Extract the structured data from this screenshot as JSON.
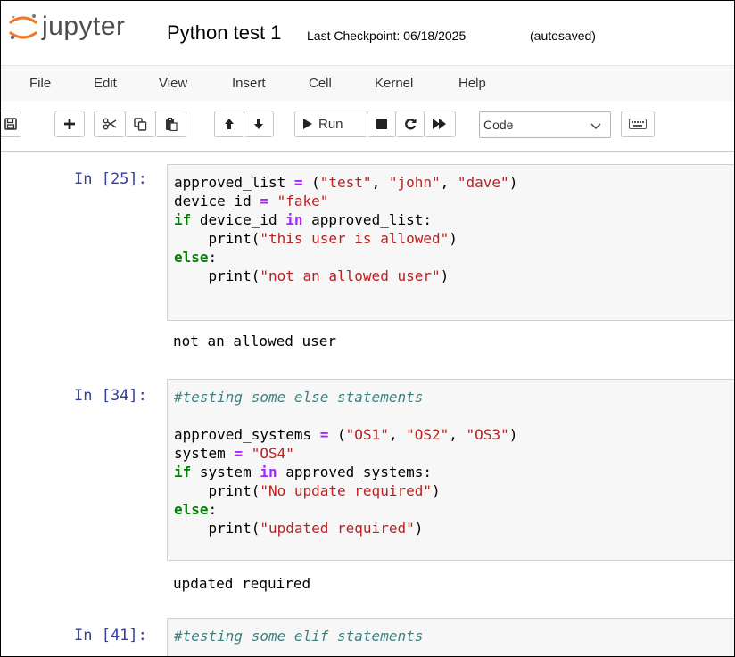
{
  "header": {
    "logo_text": "jupyter",
    "notebook_title": "Python test 1",
    "checkpoint": "Last Checkpoint: 06/18/2025",
    "autosave_status": "(autosaved)",
    "logo_color": "#f37726"
  },
  "menu": {
    "file": "File",
    "edit": "Edit",
    "view": "View",
    "insert": "Insert",
    "cell": "Cell",
    "kernel": "Kernel",
    "help": "Help"
  },
  "toolbar": {
    "run_label": "Run",
    "cell_type": "Code",
    "icons": [
      "save-icon",
      "plus-icon",
      "scissors-icon",
      "copy-icon",
      "paste-icon",
      "arrow-up-icon",
      "arrow-down-icon",
      "play-icon",
      "stop-icon",
      "restart-icon",
      "fast-forward-icon",
      "keyboard-icon"
    ]
  },
  "cells": [
    {
      "prompt": "In [25]:",
      "code_lines": [
        [
          [
            "n",
            "approved_list "
          ],
          [
            "op",
            "="
          ],
          [
            "n",
            " ("
          ],
          [
            "str",
            "\"test\""
          ],
          [
            "n",
            ", "
          ],
          [
            "str",
            "\"john\""
          ],
          [
            "n",
            ", "
          ],
          [
            "str",
            "\"dave\""
          ],
          [
            "n",
            ")"
          ]
        ],
        [
          [
            "n",
            "device_id "
          ],
          [
            "op",
            "="
          ],
          [
            "n",
            " "
          ],
          [
            "str",
            "\"fake\""
          ]
        ],
        [
          [
            "kw",
            "if"
          ],
          [
            "n",
            " device_id "
          ],
          [
            "op",
            "in"
          ],
          [
            "n",
            " approved_list:"
          ]
        ],
        [
          [
            "n",
            "    print("
          ],
          [
            "str",
            "\"this user is allowed\""
          ],
          [
            "n",
            ")"
          ]
        ],
        [
          [
            "kw",
            "else"
          ],
          [
            "n",
            ":"
          ]
        ],
        [
          [
            "n",
            "    print("
          ],
          [
            "str",
            "\"not an allowed user\""
          ],
          [
            "n",
            ")"
          ]
        ]
      ],
      "output": "not an allowed user"
    },
    {
      "prompt": "In [34]:",
      "code_lines": [
        [
          [
            "cm",
            "#testing some else statements"
          ]
        ],
        [
          [
            "n",
            ""
          ]
        ],
        [
          [
            "n",
            "approved_systems "
          ],
          [
            "op",
            "="
          ],
          [
            "n",
            " ("
          ],
          [
            "str",
            "\"OS1\""
          ],
          [
            "n",
            ", "
          ],
          [
            "str",
            "\"OS2\""
          ],
          [
            "n",
            ", "
          ],
          [
            "str",
            "\"OS3\""
          ],
          [
            "n",
            ")"
          ]
        ],
        [
          [
            "n",
            "system "
          ],
          [
            "op",
            "="
          ],
          [
            "n",
            " "
          ],
          [
            "str",
            "\"OS4\""
          ]
        ],
        [
          [
            "kw",
            "if"
          ],
          [
            "n",
            " system "
          ],
          [
            "op",
            "in"
          ],
          [
            "n",
            " approved_systems:"
          ]
        ],
        [
          [
            "n",
            "    print("
          ],
          [
            "str",
            "\"No update required\""
          ],
          [
            "n",
            ")"
          ]
        ],
        [
          [
            "kw",
            "else"
          ],
          [
            "n",
            ":"
          ]
        ],
        [
          [
            "n",
            "    print("
          ],
          [
            "str",
            "\"updated required\""
          ],
          [
            "n",
            ")"
          ]
        ]
      ],
      "output": "updated required"
    },
    {
      "prompt": "In [41]:",
      "code_lines": [
        [
          [
            "cm",
            "#testing some elif statements"
          ]
        ]
      ],
      "output": ""
    }
  ]
}
